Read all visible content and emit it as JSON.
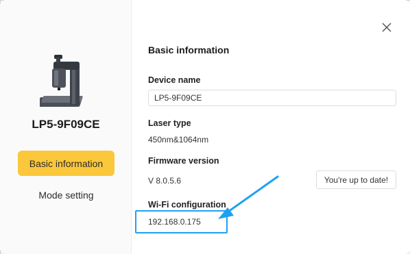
{
  "sidebar": {
    "device_name": "LP5-9F09CE",
    "items": [
      {
        "label": "Basic information",
        "active": true
      },
      {
        "label": "Mode setting",
        "active": false
      }
    ]
  },
  "main": {
    "section_title": "Basic information",
    "device_name_label": "Device name",
    "device_name_value": "LP5-9F09CE",
    "laser_type_label": "Laser type",
    "laser_type_value": "450nm&1064nm",
    "firmware_label": "Firmware version",
    "firmware_value": "V 8.0.5.6",
    "firmware_status": "You're up to date!",
    "wifi_label": "Wi-Fi configuration",
    "wifi_ip": "192.168.0.175"
  },
  "icons": {
    "close": "close-icon",
    "device": "laser-engraver-image",
    "annotation_arrow": "arrow-icon"
  },
  "colors": {
    "accent": "#fbc73b",
    "highlight": "#1ea1ef"
  }
}
